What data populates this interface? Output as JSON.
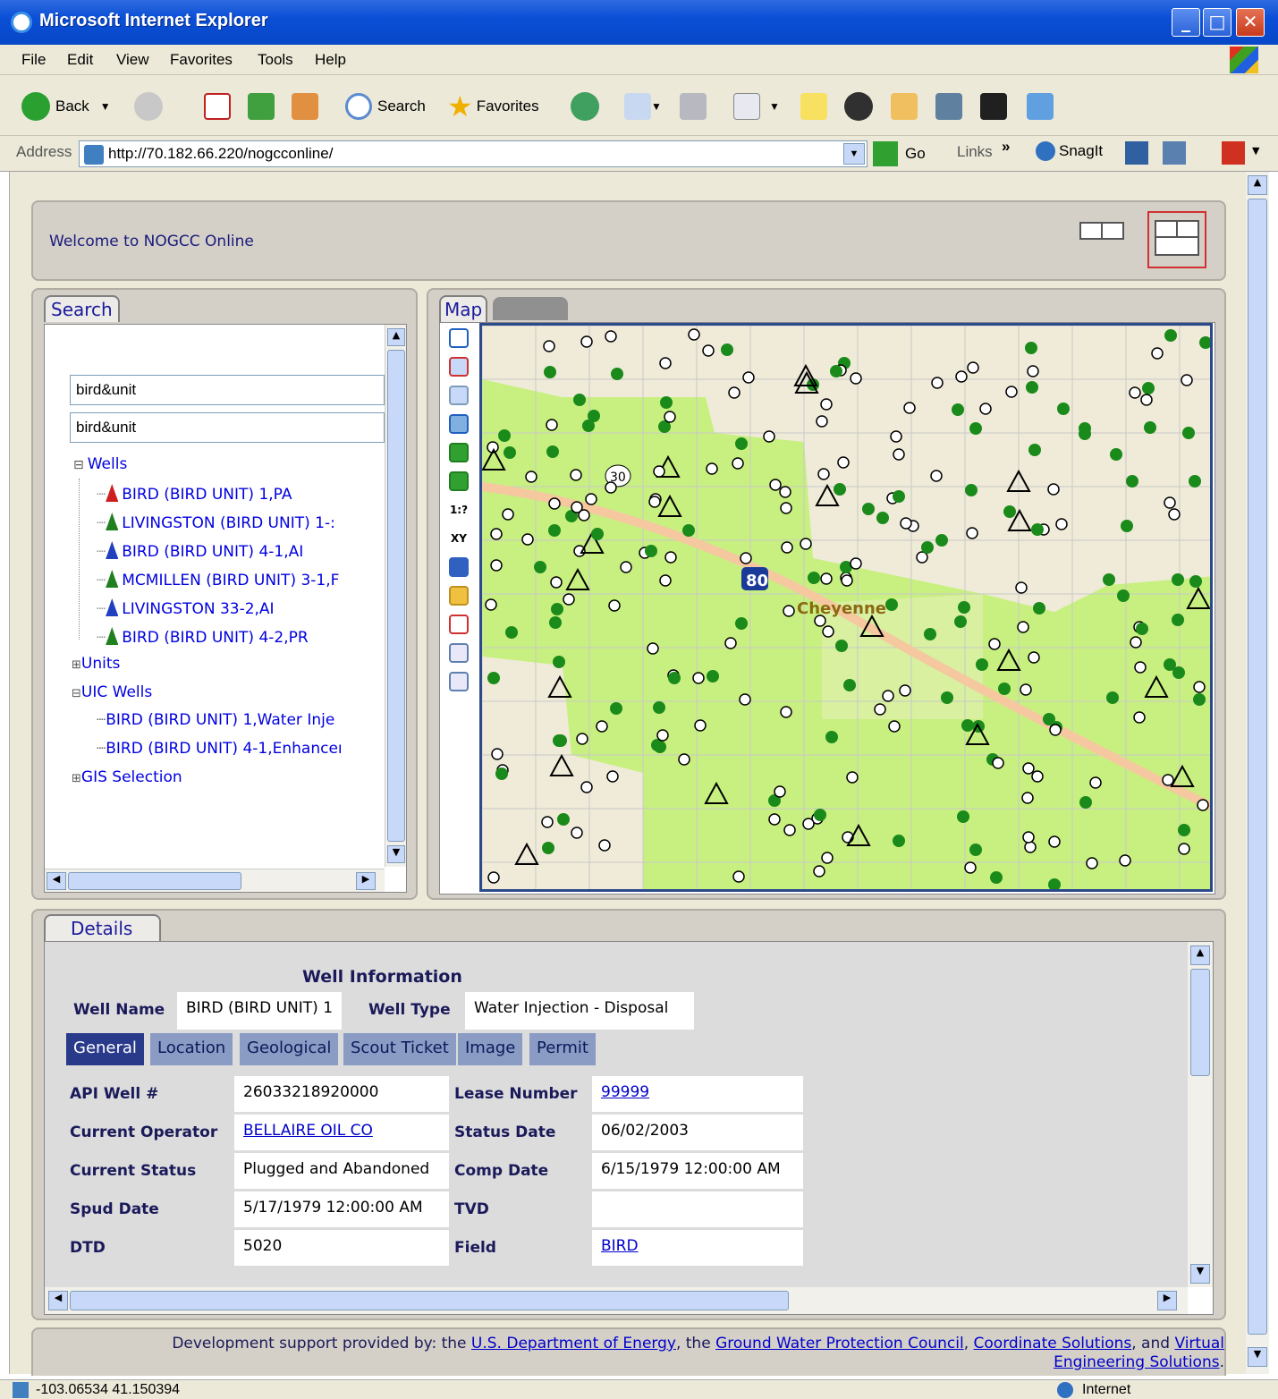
{
  "window": {
    "title": "Microsoft Internet Explorer"
  },
  "menu": [
    "File",
    "Edit",
    "View",
    "Favorites",
    "Tools",
    "Help"
  ],
  "toolbar": {
    "back": "Back",
    "search": "Search",
    "favorites": "Favorites",
    "go": "Go",
    "links": "Links",
    "snagit": "SnagIt"
  },
  "address": {
    "label": "Address",
    "url": "http://70.182.66.220/nogcconline/"
  },
  "header": {
    "welcome": "Welcome to NOGCC Online"
  },
  "search": {
    "tab": "Search",
    "input1": "bird&unit",
    "input2": "bird&unit",
    "wells_label": "Wells",
    "wells": [
      {
        "label": "BIRD (BIRD UNIT) 1,PA",
        "color": "#cc2020"
      },
      {
        "label": "LIVINGSTON (BIRD UNIT) 1-:",
        "color": "#208020"
      },
      {
        "label": "BIRD (BIRD UNIT) 4-1,AI",
        "color": "#2040c0"
      },
      {
        "label": "MCMILLEN (BIRD UNIT) 3-1,F",
        "color": "#208020"
      },
      {
        "label": "LIVINGSTON 33-2,AI",
        "color": "#2040c0"
      },
      {
        "label": "BIRD (BIRD UNIT) 4-2,PR",
        "color": "#208020"
      }
    ],
    "units": "Units",
    "uic": "UIC Wells",
    "uic_items": [
      "BIRD (BIRD UNIT) 1,Water Inje",
      "BIRD (BIRD UNIT) 4-1,Enhanceı"
    ],
    "gis": "GIS Selection"
  },
  "map": {
    "tab": "Map",
    "tools": [
      "1:?",
      "XY"
    ],
    "city": "Cheyenne",
    "hwy80": "80",
    "hwy30": "30"
  },
  "details": {
    "tab": "Details",
    "heading": "Well Information",
    "well_name_label": "Well Name",
    "well_name": "BIRD (BIRD UNIT) 1",
    "well_type_label": "Well Type",
    "well_type": "Water Injection - Disposal",
    "tabs": [
      "General",
      "Location",
      "Geological",
      "Scout Ticket",
      "Image",
      "Permit"
    ],
    "fields": [
      {
        "l1": "API Well #",
        "v1": "26033218920000",
        "l2": "Lease Number",
        "v2": "99999",
        "link1": false,
        "link2": true
      },
      {
        "l1": "Current Operator",
        "v1": "BELLAIRE OIL CO",
        "l2": "Status Date",
        "v2": "06/02/2003",
        "link1": true,
        "link2": false
      },
      {
        "l1": "Current Status",
        "v1": "Plugged and Abandoned",
        "l2": "Comp Date",
        "v2": "6/15/1979 12:00:00 AM",
        "link1": false,
        "link2": false
      },
      {
        "l1": "Spud Date",
        "v1": "5/17/1979 12:00:00 AM",
        "l2": "TVD",
        "v2": "",
        "link1": false,
        "link2": false
      },
      {
        "l1": "DTD",
        "v1": "5020",
        "l2": "Field",
        "v2": "BIRD",
        "link1": false,
        "link2": true
      }
    ]
  },
  "footer": {
    "prefix": "Development support provided by: the",
    "doe": "U.S. Department of Energy",
    "mid": ", the",
    "gwpc": "Ground Water Protection Council",
    "cs": "Coordinate Solutions",
    "and": ", and",
    "ves1": "Virtual",
    "ves2": "Engineering Solutions"
  },
  "status": {
    "coords": "-103.06534 41.150394",
    "zone": "Internet"
  }
}
